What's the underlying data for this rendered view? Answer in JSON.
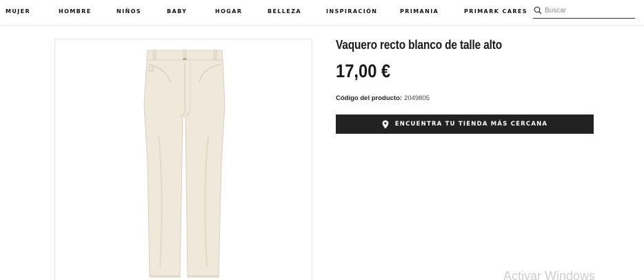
{
  "nav": {
    "items": [
      "MUJER",
      "HOMBRE",
      "NIÑOS",
      "BABY",
      "HOGAR",
      "BELLEZA",
      "INSPIRACIÓN",
      "PRIMANIA",
      "PRIMARK CARES"
    ],
    "search_placeholder": "Buscar",
    "search_icon": "search-icon"
  },
  "product": {
    "title": "Vaquero recto blanco de talle alto",
    "price": "17,00 €",
    "code_label": "Código del producto:",
    "code_value": "2049805",
    "image_description_icon": "jeans-image",
    "store_button_label": "ENCUENTRA TU TIENDA MÁS CERCANA",
    "store_button_icon": "location-pin-icon"
  },
  "system": {
    "watermark": "Activar Windows"
  },
  "colors": {
    "button_bg": "#222222",
    "jeans": "#efe9dc"
  }
}
